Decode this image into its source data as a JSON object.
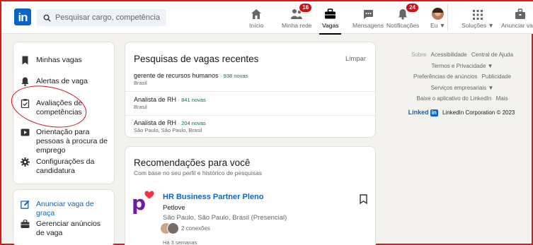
{
  "nav": {
    "logo": "in",
    "search_placeholder": "Pesquisar cargo, competência ou empr…",
    "items": [
      {
        "label": "Início"
      },
      {
        "label": "Minha rede",
        "badge": "16"
      },
      {
        "label": "Vagas"
      },
      {
        "label": "Mensagens"
      },
      {
        "label": "Notificações",
        "badge": "24"
      },
      {
        "label": "Eu ▼"
      },
      {
        "label": "Soluções ▼"
      },
      {
        "label": "Anunciar vaga"
      }
    ]
  },
  "sidebar": {
    "items": [
      {
        "label": "Minhas vagas"
      },
      {
        "label": "Alertas de vaga"
      },
      {
        "label": "Avaliações de competências"
      },
      {
        "label": "Orientação para pessoas à procura de emprego"
      },
      {
        "label": "Configurações da candidatura"
      }
    ],
    "post_job": "Anunciar vaga de graça",
    "manage_jobs": "Gerenciar anúncios de vaga"
  },
  "recent": {
    "title": "Pesquisas de vagas recentes",
    "clear": "Limpar",
    "items": [
      {
        "title": "gerente de recursos humanos",
        "new": "· 938 novas",
        "loc": "Brasil"
      },
      {
        "title": "Analista de RH",
        "new": "· 841 novas",
        "loc": "Brasil"
      },
      {
        "title": "Analista de RH",
        "new": "· 204 novas",
        "loc": "São Paulo, São Paulo, Brasil"
      }
    ]
  },
  "recs": {
    "title": "Recomendações para você",
    "subtitle": "Com base no seu perfil e histórico de pesquisas",
    "job": {
      "title": "HR Business Partner Pleno",
      "company": "Petlove",
      "location": "São Paulo, São Paulo, Brasil (Presencial)",
      "connections": "2 conexões",
      "posted": "Há 3 semanas"
    }
  },
  "footer": {
    "links": [
      "Sobre",
      "Acessibilidade",
      "Central de Ajuda",
      "Termos e Privacidade ▼",
      "Preferências de anúncios",
      "Publicidade",
      "Serviços empresariais ▼",
      "Baixe o aplicativo do LinkedIn",
      "Mais"
    ],
    "brand_text": "LinkedIn Corporation © 2023",
    "brand_word": "Linked"
  },
  "colors": {
    "brand": "#0a66c2",
    "badge": "#cc1016",
    "new": "#057642"
  }
}
